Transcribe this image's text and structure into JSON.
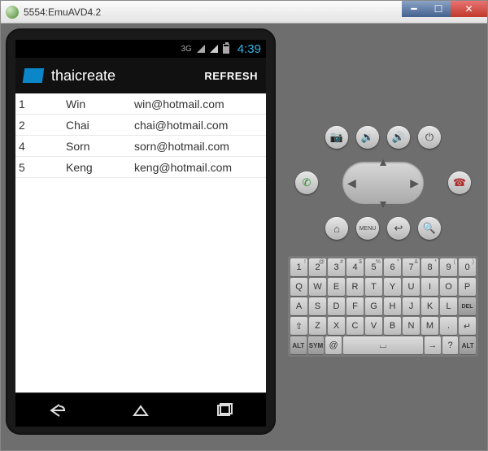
{
  "window": {
    "title": "5554:EmuAVD4.2"
  },
  "statusbar": {
    "network_label": "3G",
    "clock": "4:39"
  },
  "appbar": {
    "title": "thaicreate",
    "refresh": "REFRESH"
  },
  "rows": [
    {
      "id": "1",
      "name": "Win",
      "email": "win@hotmail.com"
    },
    {
      "id": "2",
      "name": "Chai",
      "email": "chai@hotmail.com"
    },
    {
      "id": "4",
      "name": "Sorn",
      "email": "sorn@hotmail.com"
    },
    {
      "id": "5",
      "name": "Keng",
      "email": "keng@hotmail.com"
    }
  ],
  "controls": {
    "menu_label": "MENU"
  },
  "keyboard": {
    "row1_sup": [
      "!",
      "@",
      "#",
      "$",
      "%",
      "^",
      "&",
      "*",
      "(",
      ")"
    ],
    "row1": [
      "1",
      "2",
      "3",
      "4",
      "5",
      "6",
      "7",
      "8",
      "9",
      "0"
    ],
    "row2": [
      "Q",
      "W",
      "E",
      "R",
      "T",
      "Y",
      "U",
      "I",
      "O",
      "P"
    ],
    "row3": [
      "A",
      "S",
      "D",
      "F",
      "G",
      "H",
      "J",
      "K",
      "L",
      "DEL"
    ],
    "row4": [
      "⇧",
      "Z",
      "X",
      "C",
      "V",
      "B",
      "N",
      "M",
      ".",
      "↵"
    ],
    "row5": [
      "ALT",
      "SYM",
      "@",
      "␣",
      "→",
      "?",
      "ALT"
    ]
  }
}
